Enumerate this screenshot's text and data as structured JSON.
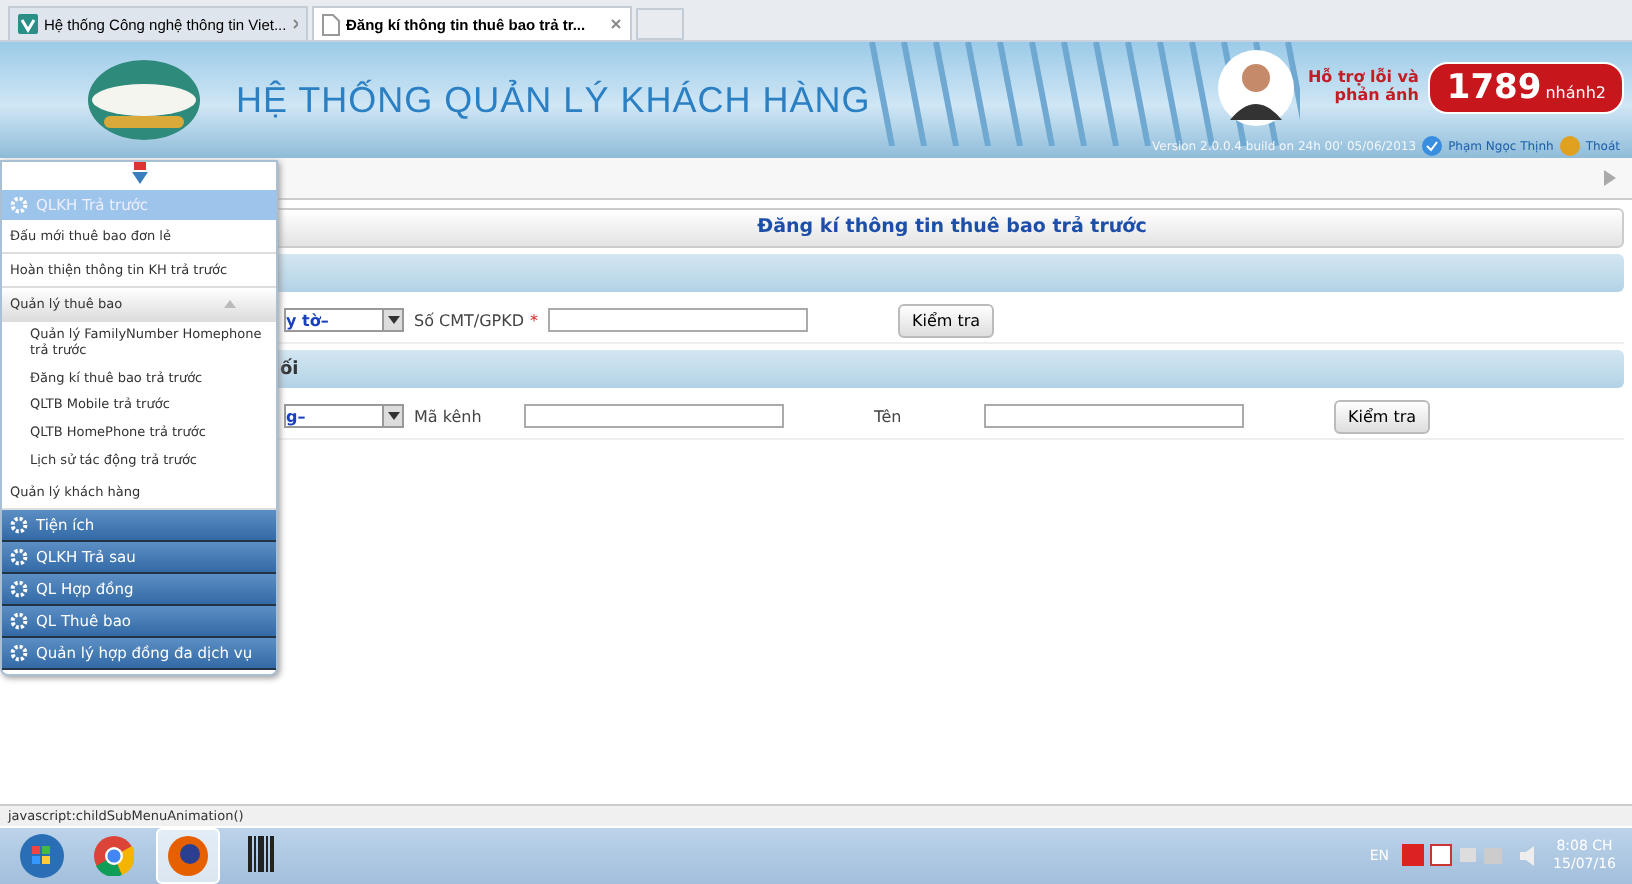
{
  "browser_tabs": [
    {
      "title": "Hệ thống Công nghệ thông tin Viet...",
      "selected": false,
      "kind": "brand"
    },
    {
      "title": "Đăng kí thông tin thuê bao trả tr...",
      "selected": true,
      "kind": "page"
    }
  ],
  "header": {
    "title": "HỆ THỐNG QUẢN LÝ KHÁCH HÀNG",
    "support_label": "Hỗ trợ lỗi và phản ánh",
    "hotline": "1789",
    "branch": "nhánh2",
    "version": "Version 2.0.0.4 build on 24h 00' 05/06/2013",
    "user": "Phạm Ngọc Thịnh",
    "logout": "Thoát"
  },
  "menu": [
    {
      "label": "QLKH Trả trước",
      "expanded": true,
      "items": [
        {
          "label": "Đấu mới thuê bao đơn lẻ"
        },
        {
          "label": "Hoàn thiện thông tin KH trả trước"
        },
        {
          "label": "Quản lý thuê bao",
          "expanded": true,
          "children": [
            {
              "label": "Quản lý FamilyNumber Homephone trả trước"
            },
            {
              "label": "Đăng kí thuê bao trả trước"
            },
            {
              "label": "QLTB Mobile trả trước"
            },
            {
              "label": "QLTB HomePhone trả trước"
            },
            {
              "label": "Lịch sử tác động trả trước"
            }
          ]
        },
        {
          "label": "Quản lý khách hàng"
        }
      ]
    },
    {
      "label": "Tiện ích",
      "expanded": false
    },
    {
      "label": "QLKH Trả sau",
      "expanded": false
    },
    {
      "label": "QL Hợp đồng",
      "expanded": false
    },
    {
      "label": "QL Thuê bao",
      "expanded": false
    },
    {
      "label": "Quản lý hợp đồng đa dịch vụ",
      "expanded": false
    }
  ],
  "page_title": "Đăng kí thông tin thuê bao trả trước",
  "sections": [
    {
      "fields": [
        {
          "kind": "select",
          "value": "y tờ–"
        },
        {
          "kind": "label",
          "text": "Số CMT/GPKD",
          "mark": "*"
        },
        {
          "kind": "input"
        },
        {
          "kind": "button",
          "text": "Kiểm tra"
        }
      ]
    },
    {
      "heading": "ối",
      "fields": [
        {
          "kind": "select",
          "value": "g–"
        },
        {
          "kind": "label",
          "text": "Mã kênh"
        },
        {
          "kind": "input"
        },
        {
          "kind": "label",
          "text": "Tên"
        },
        {
          "kind": "input"
        },
        {
          "kind": "button",
          "text": "Kiểm tra"
        }
      ]
    }
  ],
  "status_bar": "javascript:childSubMenuAnimation()",
  "taskbar": {
    "apps": [
      {
        "kind": "start",
        "selected": false
      },
      {
        "kind": "chrome",
        "selected": false
      },
      {
        "kind": "firefox",
        "selected": true
      },
      {
        "kind": "barcode",
        "selected": false
      }
    ],
    "language": "EN",
    "time": "8:08 CH",
    "date": "15/07/16"
  }
}
